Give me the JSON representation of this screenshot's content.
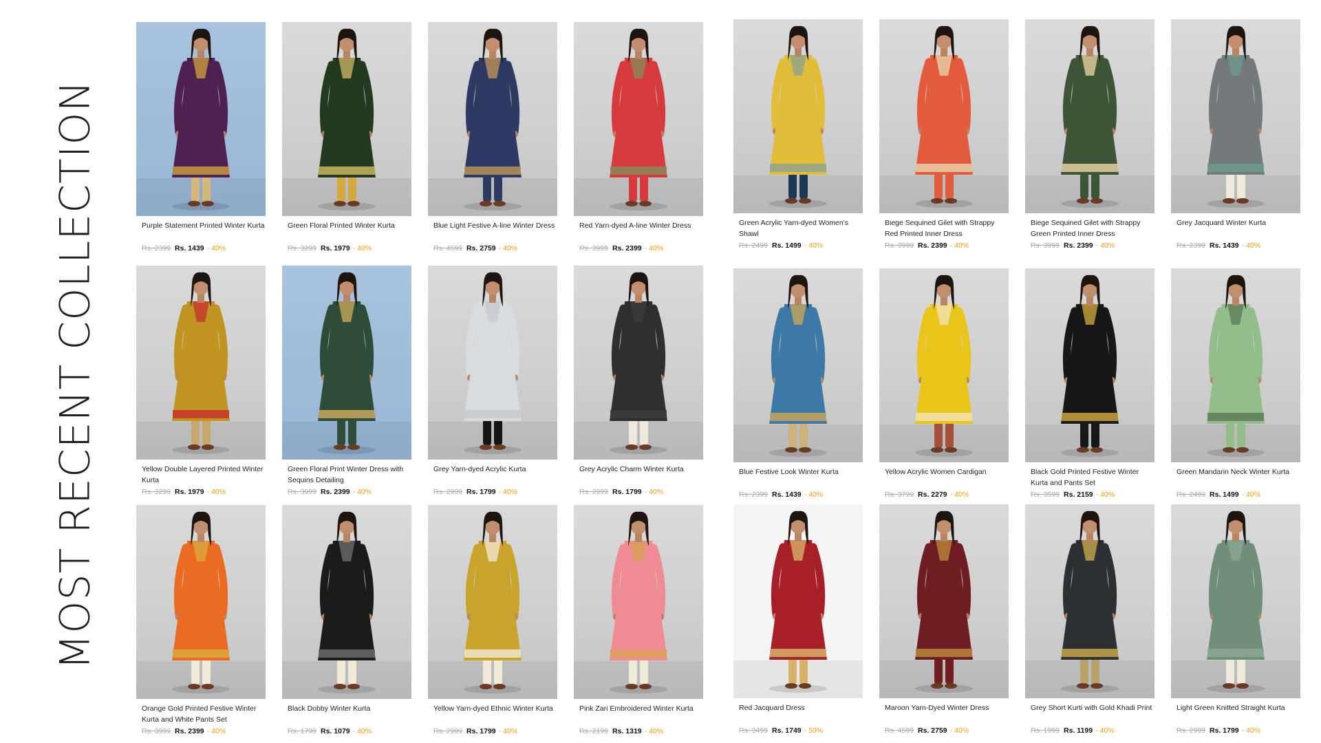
{
  "page": {
    "title": "MOST RECENT COLLECTION"
  },
  "products": [
    {
      "name": "Purple Statement Printed Winter Kurta",
      "old_price": "Rs. 2399",
      "price": "Rs. 1439",
      "discount": "- 40%",
      "garment": "#4e2150",
      "accent": "#c99a3b",
      "legs": "#d6b77a",
      "bg": "blue"
    },
    {
      "name": "Green Floral Printed Winter Kurta",
      "old_price": "Rs. 3299",
      "price": "Rs. 1979",
      "discount": "- 40%",
      "garment": "#223a20",
      "accent": "#c8b35f",
      "legs": "#d4a940",
      "bg": "grey"
    },
    {
      "name": "Blue Light Festive A-line Winter Dress",
      "old_price": "Rs. 4599",
      "price": "Rs. 2759",
      "discount": "- 40%",
      "garment": "#2f3a63",
      "accent": "#b99257",
      "legs": "#2f3a63",
      "bg": "grey"
    },
    {
      "name": "Red Yarn-dyed A-line Winter Dress",
      "old_price": "Rs. 3999",
      "price": "Rs. 2399",
      "discount": "- 40%",
      "garment": "#d63a3f",
      "accent": "#8a8a5a",
      "legs": "#d63a3f",
      "bg": "grey"
    },
    {
      "name": "Green Acrylic Yarn-dyed Women's Shawl",
      "old_price": "Rs. 2499",
      "price": "Rs. 1499",
      "discount": "- 40%",
      "garment": "#e2bd3a",
      "accent": "#8da38d",
      "legs": "#1d3857",
      "bg": "grey"
    },
    {
      "name": "Biege Sequined Gilet with Strappy Red Printed Inner Dress",
      "old_price": "Rs. 3999",
      "price": "Rs. 2399",
      "discount": "- 40%",
      "garment": "#e25b3c",
      "accent": "#e8d0a6",
      "legs": "#e25b3c",
      "bg": "grey"
    },
    {
      "name": "Biege Sequined Gilet with Strappy Green Printed Inner Dress",
      "old_price": "Rs. 3999",
      "price": "Rs. 2399",
      "discount": "- 40%",
      "garment": "#3d5437",
      "accent": "#e2cf9e",
      "legs": "#3d5437",
      "bg": "grey"
    },
    {
      "name": "Grey Jacquard Winter Kurta",
      "old_price": "Rs. 2399",
      "price": "Rs. 1439",
      "discount": "- 40%",
      "garment": "#74797b",
      "accent": "#6c9a8c",
      "legs": "#efe9dc",
      "bg": "grey"
    },
    {
      "name": "Yellow Double Layered Printed Winter Kurta",
      "old_price": "Rs. 3299",
      "price": "Rs. 1979",
      "discount": "- 40%",
      "garment": "#c09420",
      "accent": "#c6352e",
      "legs": "#c7a96b",
      "bg": "grey"
    },
    {
      "name": "Green Floral Print Winter Dress with Sequins Detailing",
      "old_price": "Rs. 3999",
      "price": "Rs. 2399",
      "discount": "- 40%",
      "garment": "#2e4d38",
      "accent": "#c8a85a",
      "legs": "#2e4d38",
      "bg": "blue"
    },
    {
      "name": "Grey Yarn-dyed Acrylic Kurta",
      "old_price": "Rs. 2999",
      "price": "Rs. 1799",
      "discount": "- 40%",
      "garment": "#d9dcdf",
      "accent": "#c7cacc",
      "legs": "#151515",
      "bg": "grey"
    },
    {
      "name": "Grey Acrylic Charm Winter Kurta",
      "old_price": "Rs. 2999",
      "price": "Rs. 1799",
      "discount": "- 40%",
      "garment": "#2f302e",
      "accent": "#3c3d3a",
      "legs": "#efe9dc",
      "bg": "grey"
    },
    {
      "name": "Blue Festive Look Winter Kurta",
      "old_price": "Rs. 2399",
      "price": "Rs. 1439",
      "discount": "- 40%",
      "garment": "#3c79a6",
      "accent": "#c8a65a",
      "legs": "#cdb27b",
      "bg": "grey"
    },
    {
      "name": "Yellow Acrylic Women Cardigan",
      "old_price": "Rs. 3799",
      "price": "Rs. 2279",
      "discount": "- 40%",
      "garment": "#e9c419",
      "accent": "#f0e2b0",
      "legs": "#a4503a",
      "bg": "grey"
    },
    {
      "name": "Black Gold Printed Festive Winter Kurta and Pants Set",
      "old_price": "Rs. 3599",
      "price": "Rs. 2159",
      "discount": "- 40%",
      "garment": "#171717",
      "accent": "#c9a23c",
      "legs": "#171717",
      "bg": "grey"
    },
    {
      "name": "Green Mandarin Neck Winter Kurta",
      "old_price": "Rs. 2499",
      "price": "Rs. 1499",
      "discount": "- 40%",
      "garment": "#93bd8a",
      "accent": "#5e7c5a",
      "legs": "#93bd8a",
      "bg": "grey"
    },
    {
      "name": "Orange Gold Printed Festive Winter Kurta and White Pants Set",
      "old_price": "Rs. 3999",
      "price": "Rs. 2399",
      "discount": "- 40%",
      "garment": "#ea6c23",
      "accent": "#d9a93a",
      "legs": "#f1ead8",
      "bg": "grey"
    },
    {
      "name": "Black Dobby Winter Kurta",
      "old_price": "Rs. 1799",
      "price": "Rs. 1079",
      "discount": "- 40%",
      "garment": "#1b1b1b",
      "accent": "#6a6a6a",
      "legs": "#f1ead8",
      "bg": "grey"
    },
    {
      "name": "Yellow Yarn-dyed Ethnic Winter Kurta",
      "old_price": "Rs. 2999",
      "price": "Rs. 1799",
      "discount": "- 40%",
      "garment": "#c9a42c",
      "accent": "#f0e5cc",
      "legs": "#f1ead8",
      "bg": "grey"
    },
    {
      "name": "Pink Zari Embroidered Winter Kurta",
      "old_price": "Rs. 2199",
      "price": "Rs. 1319",
      "discount": "- 40%",
      "garment": "#ef8c93",
      "accent": "#d9a05a",
      "legs": "#f1ead8",
      "bg": "grey"
    },
    {
      "name": "Red Jacquard Dress",
      "old_price": "Rs. 3499",
      "price": "Rs. 1749",
      "discount": "- 50%",
      "garment": "#a72027",
      "accent": "#d8b06a",
      "legs": "#d8b06a",
      "bg": "white"
    },
    {
      "name": "Maroon Yarn-Dyed Winter Dress",
      "old_price": "Rs. 4599",
      "price": "Rs. 2759",
      "discount": "- 40%",
      "garment": "#6e1e22",
      "accent": "#b9853a",
      "legs": "#6e1e22",
      "bg": "grey"
    },
    {
      "name": "Grey Short Kurti with Gold Khadi Print",
      "old_price": "Rs. 1999",
      "price": "Rs. 1199",
      "discount": "- 40%",
      "garment": "#2c3035",
      "accent": "#c7a64a",
      "legs": "#b9a167",
      "bg": "grey"
    },
    {
      "name": "Light Green Knitted Straight Kurta",
      "old_price": "Rs. 2999",
      "price": "Rs. 1799",
      "discount": "- 40%",
      "garment": "#6f8f7b",
      "accent": "#8aa895",
      "legs": "#efe9dc",
      "bg": "grey"
    }
  ]
}
